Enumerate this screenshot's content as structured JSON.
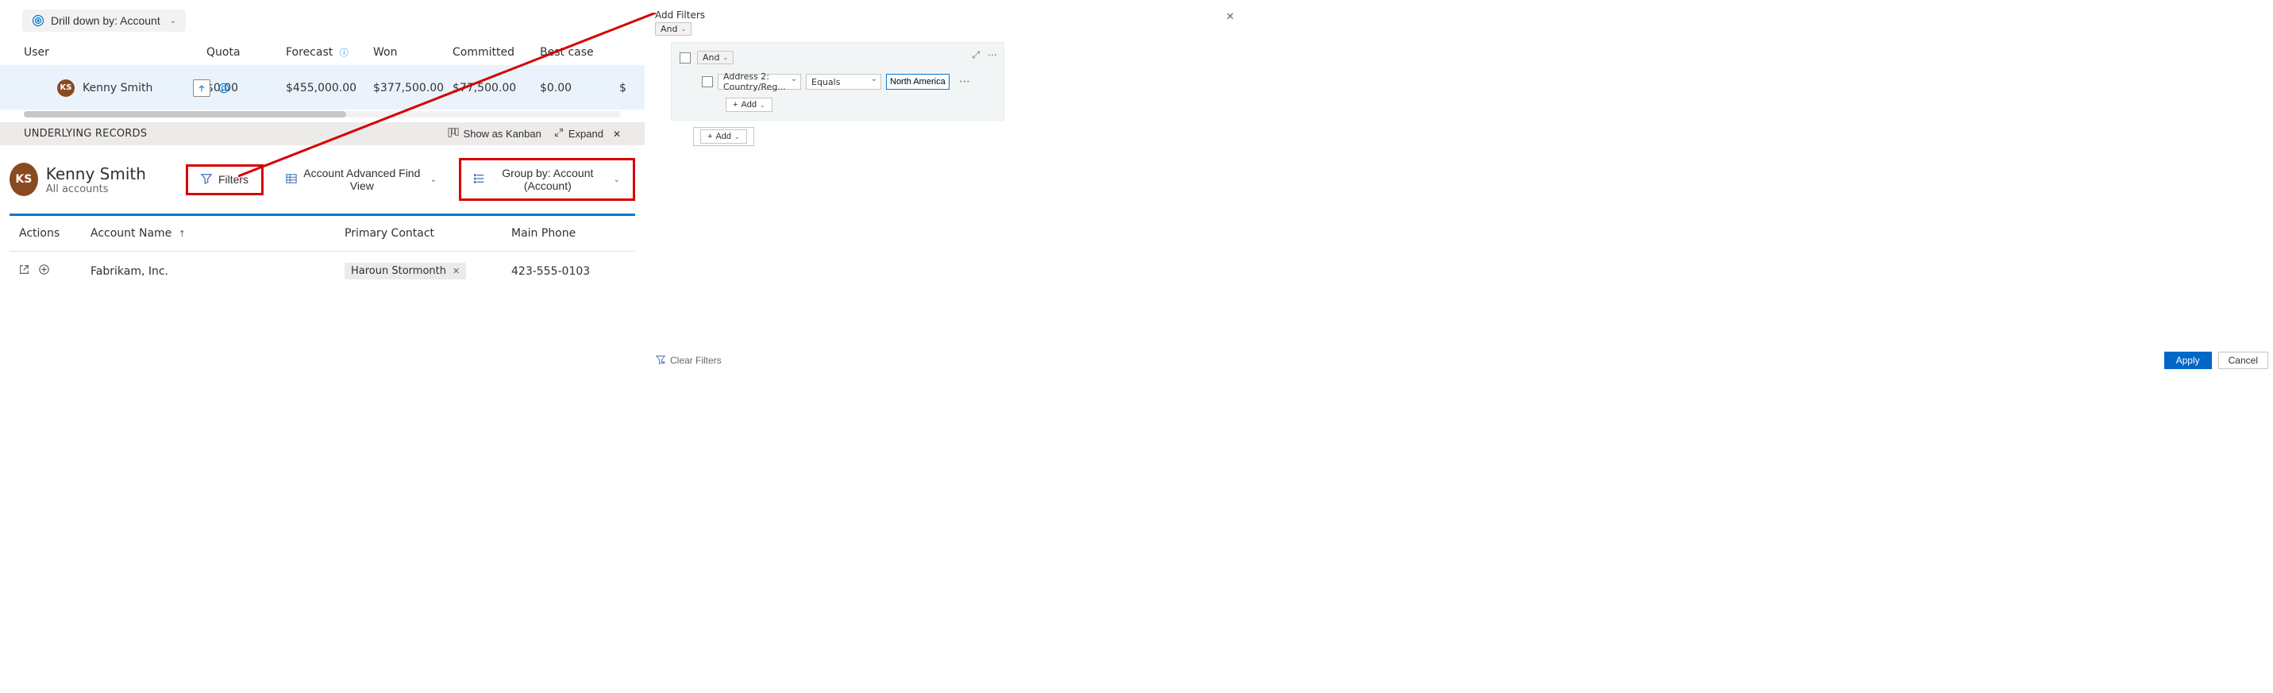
{
  "drilldown": {
    "label": "Drill down by: Account"
  },
  "grid": {
    "headers": {
      "user": "User",
      "quota": "Quota",
      "forecast": "Forecast",
      "won": "Won",
      "committed": "Committed",
      "bestcase": "Best case"
    },
    "row": {
      "avatar": "KS",
      "user": "Kenny Smith",
      "quota": "$0.00",
      "forecast": "$455,000.00",
      "won": "$377,500.00",
      "committed": "$77,500.00",
      "bestcase": "$0.00",
      "nextval_prefix": "$"
    }
  },
  "underlying": {
    "label": "UNDERLYING RECORDS",
    "kanban": "Show as Kanban",
    "expand": "Expand"
  },
  "record_header": {
    "avatar": "KS",
    "title": "Kenny Smith",
    "subtitle": "All accounts",
    "filters_btn": "Filters",
    "view_btn": "Account Advanced Find View",
    "groupby_btn": "Group by:  Account (Account)"
  },
  "table": {
    "col_actions": "Actions",
    "col_account": "Account Name",
    "col_contact": "Primary Contact",
    "col_phone": "Main Phone",
    "row": {
      "account": "Fabrikam, Inc.",
      "contact": "Haroun Stormonth",
      "phone": "423-555-0103"
    }
  },
  "filter_panel": {
    "title": "Add Filters",
    "and": "And",
    "field": "Address 2: Country/Reg...",
    "operator": "Equals",
    "value": "North America",
    "add": "Add"
  },
  "footer": {
    "clear": "Clear Filters",
    "apply": "Apply",
    "cancel": "Cancel"
  }
}
